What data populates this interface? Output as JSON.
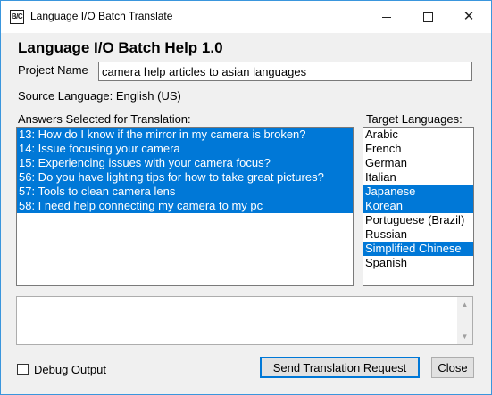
{
  "window": {
    "icon_text": "B/C",
    "title": "Language I/O Batch Translate",
    "controls": {
      "minimize": "",
      "maximize": "",
      "close": "✕"
    }
  },
  "heading": "Language I/O Batch Help 1.0",
  "project": {
    "label": "Project Name",
    "value": "camera help articles to asian languages"
  },
  "source_language": "Source Language: English (US)",
  "answers": {
    "label": "Answers Selected for Translation:",
    "items": [
      {
        "text": "13: How do I know if the mirror in my camera is broken?",
        "selected": true
      },
      {
        "text": "14: Issue focusing your camera",
        "selected": true
      },
      {
        "text": "15: Experiencing issues with your camera focus?",
        "selected": true
      },
      {
        "text": "56: Do you have lighting tips for how to take great pictures?",
        "selected": true
      },
      {
        "text": "57: Tools to clean camera lens",
        "selected": true
      },
      {
        "text": "58: I need help connecting my camera to my pc",
        "selected": true
      }
    ]
  },
  "targets": {
    "label": "Target Languages:",
    "items": [
      {
        "text": "Arabic",
        "selected": false
      },
      {
        "text": "French",
        "selected": false
      },
      {
        "text": "German",
        "selected": false
      },
      {
        "text": "Italian",
        "selected": false
      },
      {
        "text": "Japanese",
        "selected": true
      },
      {
        "text": "Korean",
        "selected": true
      },
      {
        "text": "Portuguese (Brazil)",
        "selected": false
      },
      {
        "text": "Russian",
        "selected": false
      },
      {
        "text": "Simplified Chinese",
        "selected": true
      },
      {
        "text": "Spanish",
        "selected": false
      }
    ]
  },
  "output": {
    "value": ""
  },
  "debug": {
    "label": "Debug Output",
    "checked": false
  },
  "buttons": {
    "send": "Send Translation Request",
    "close": "Close"
  },
  "colors": {
    "selection": "#0078d7",
    "focus_border": "#0078d7",
    "window_border": "#3a96dd"
  }
}
